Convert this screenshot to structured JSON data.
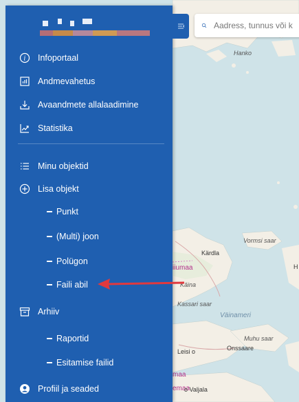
{
  "search": {
    "placeholder": "Aadress, tunnus või k"
  },
  "menu": {
    "top": [
      {
        "id": "infoportaal",
        "label": "Infoportaal",
        "icon": "info-icon"
      },
      {
        "id": "andmevahetus",
        "label": "Andmevahetus",
        "icon": "data-exchange-icon"
      },
      {
        "id": "avaandmete",
        "label": "Avaandmete allalaadimine",
        "icon": "download-icon"
      },
      {
        "id": "statistika",
        "label": "Statistika",
        "icon": "statistics-icon"
      }
    ],
    "minu_objektid": "Minu objektid",
    "lisa_objekt": "Lisa objekt",
    "lisa_sub": [
      "Punkt",
      "(Multi) joon",
      "Polügon",
      "Faili abil"
    ],
    "arhiiv": "Arhiiv",
    "arhiiv_sub": [
      "Raportid",
      "Esitamise failid"
    ],
    "profiil": "Profiil ja seaded"
  },
  "map_labels": {
    "hanko": "Hanko",
    "vormsi": "Vormsi saar",
    "kardla": "Kärdla",
    "hiiumaa": "iiumaa",
    "kassari": "Kassari saar",
    "vainameri": "Väinameri",
    "muhu": "Muhu saar",
    "onssaare": "Onssaare",
    "leisi": "Leisi o",
    "maa": "maa",
    "valjala": "o Valjala",
    "emaa": "emaa",
    "kaina": "Käina",
    "h": "H"
  },
  "colors": {
    "sidebar": "#1f5fb0",
    "arrow": "#e0393e",
    "land": "#f3efe6",
    "water": "#cfe3e8"
  }
}
